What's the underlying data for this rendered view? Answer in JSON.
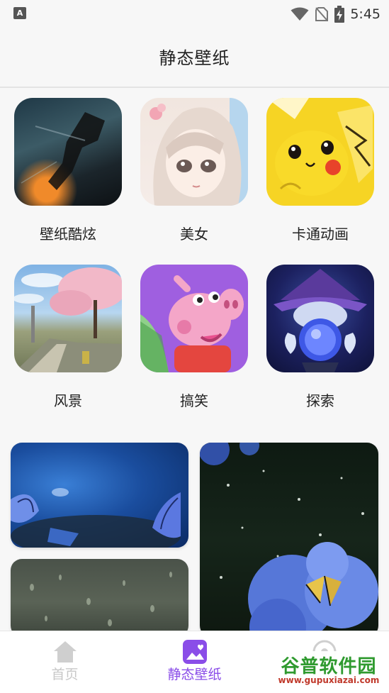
{
  "status_bar": {
    "time": "5:45",
    "left_icon_letter": "A",
    "icons": [
      "wifi-icon",
      "no-sim-icon",
      "battery-charging-icon"
    ]
  },
  "header": {
    "title": "静态壁纸"
  },
  "categories": [
    {
      "label": "壁纸酷炫",
      "icon": "action-figure-thumbnail"
    },
    {
      "label": "美女",
      "icon": "anime-girl-thumbnail"
    },
    {
      "label": "卡通动画",
      "icon": "pikachu-thumbnail"
    },
    {
      "label": "风景",
      "icon": "cherry-blossom-scene-thumbnail"
    },
    {
      "label": "搞笑",
      "icon": "peppa-pig-thumbnail"
    },
    {
      "label": "探索",
      "icon": "wizard-crystal-ball-thumbnail"
    }
  ],
  "wallpapers": [
    {
      "icon": "blue-butterflies-wallpaper"
    },
    {
      "icon": "hydrangea-butterfly-wallpaper"
    },
    {
      "icon": "raindrops-wallpaper"
    }
  ],
  "bottom_nav": {
    "items": [
      {
        "label": "首页",
        "icon": "home-icon",
        "active": false
      },
      {
        "label": "静态壁纸",
        "icon": "picture-icon",
        "active": true
      },
      {
        "label": "",
        "icon": "explore-icon",
        "active": false
      }
    ],
    "active_color": "#8a4de8",
    "inactive_color": "#c8c8c8"
  },
  "watermark": {
    "title": "谷普软件园",
    "url": "www.gupuxiazai.com"
  }
}
